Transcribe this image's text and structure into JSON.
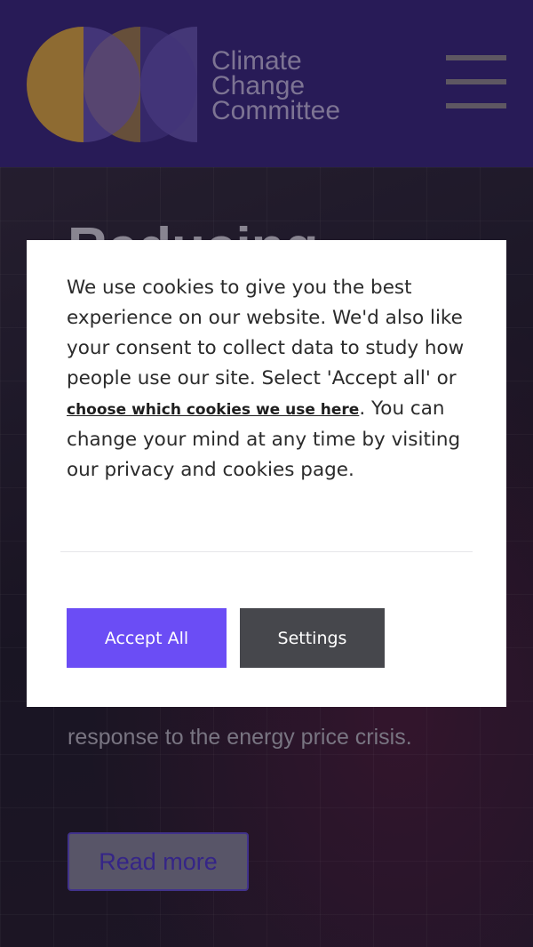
{
  "header": {
    "logo_lines": [
      "Climate",
      "Change",
      "Committee"
    ],
    "colors": {
      "background": "#2e1f63",
      "logo_gold": "#d4a12a",
      "logo_purple": "#5b4a9a",
      "logo_text": "#8f84a8"
    },
    "menu_icon": "hamburger-menu-icon"
  },
  "hero": {
    "title_partial": "Reducing",
    "description": "response to the energy price crisis.",
    "read_more_label": "Read more"
  },
  "cookie_banner": {
    "text_before_link": "We use cookies to give you the best experience on our website. We'd also like your consent to collect data to study how people use our site. Select 'Accept all' or ",
    "link_text": "choose which cookies we use here",
    "text_after_link": ". You can change your mind at any time by visiting our privacy and cookies page.",
    "accept_label": "Accept All",
    "settings_label": "Settings",
    "colors": {
      "accept": "#6b4df5",
      "settings": "#46474c"
    }
  }
}
